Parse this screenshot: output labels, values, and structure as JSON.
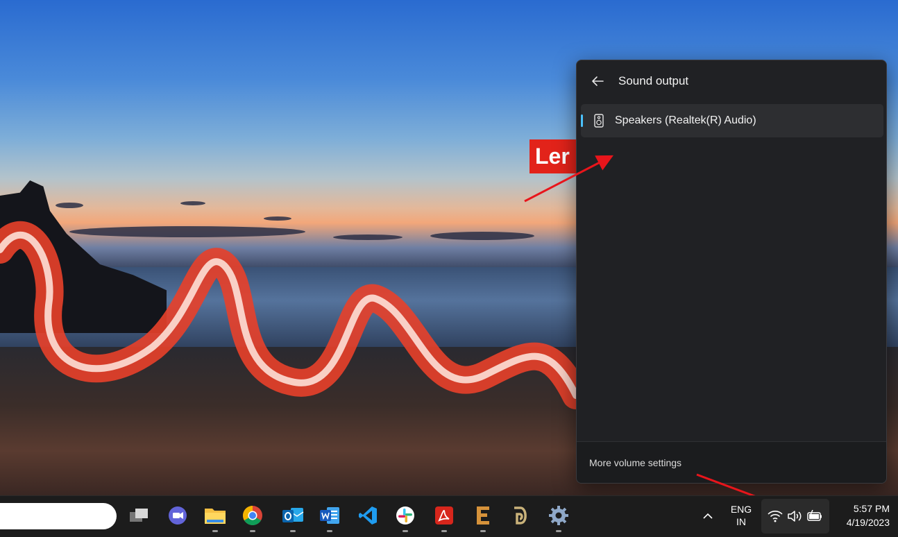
{
  "wallpaper": {
    "brand_fragment": "Ler"
  },
  "flyout": {
    "title": "Sound output",
    "devices": [
      {
        "label": "Speakers (Realtek(R) Audio)",
        "selected": true,
        "icon": "speaker-icon"
      }
    ],
    "footer_link": "More volume settings"
  },
  "taskbar": {
    "apps": [
      {
        "name": "task-view",
        "icon": "task-view-icon"
      },
      {
        "name": "meet-chat",
        "icon": "video-chat-icon"
      },
      {
        "name": "file-explorer",
        "icon": "folder-icon"
      },
      {
        "name": "chrome",
        "icon": "chrome-icon"
      },
      {
        "name": "outlook",
        "icon": "outlook-icon"
      },
      {
        "name": "word",
        "icon": "word-icon"
      },
      {
        "name": "vscode",
        "icon": "vscode-icon"
      },
      {
        "name": "slack",
        "icon": "slack-icon"
      },
      {
        "name": "acrobat",
        "icon": "pdf-icon"
      },
      {
        "name": "app-e",
        "icon": "letter-e-icon"
      },
      {
        "name": "app-d",
        "icon": "letter-d-icon"
      },
      {
        "name": "settings",
        "icon": "gear-icon"
      }
    ],
    "language": {
      "line1": "ENG",
      "line2": "IN"
    },
    "clock": {
      "time": "5:57 PM",
      "date": "4/19/2023"
    }
  },
  "colors": {
    "accent": "#4cc2ff",
    "flyout_bg": "#202124",
    "annotation_arrow": "#e8151b",
    "brand_red": "#e2231a"
  }
}
